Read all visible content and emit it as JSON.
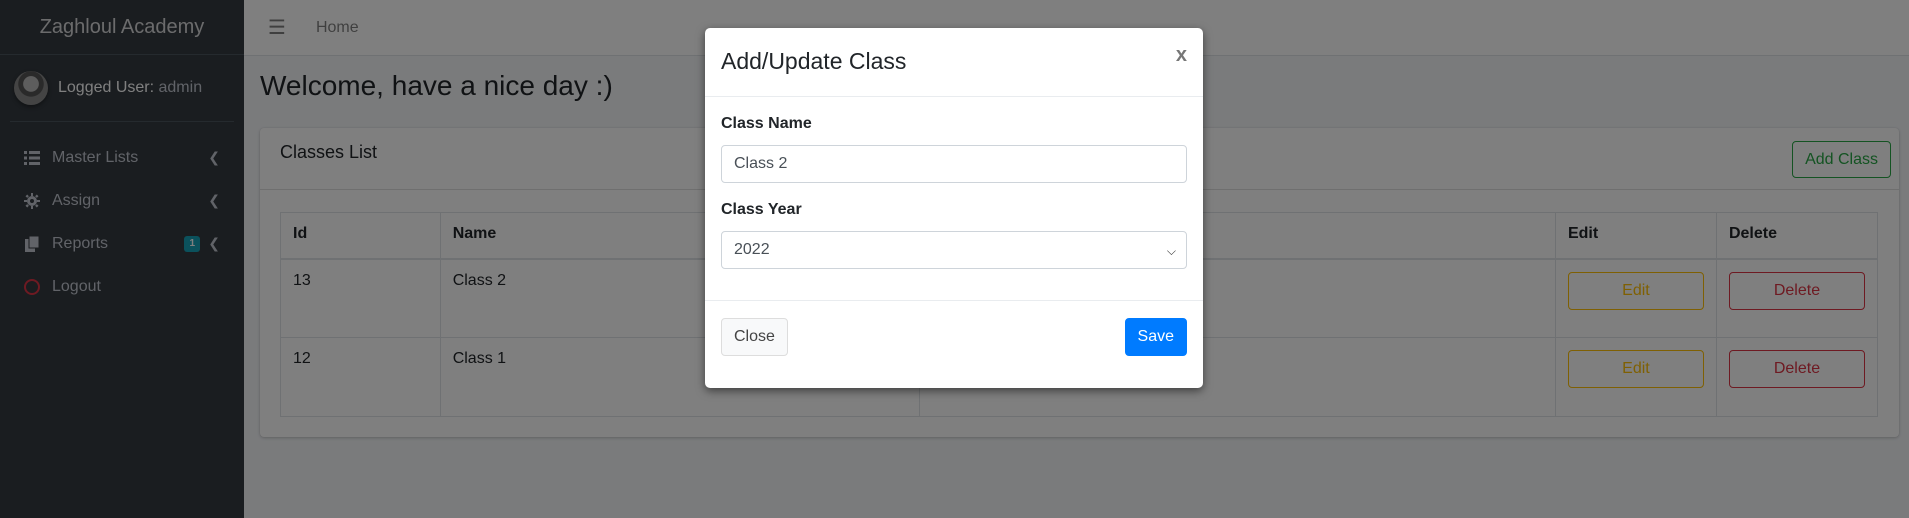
{
  "sidebar": {
    "brand": "Zaghloul Academy",
    "user_label": "Logged User:",
    "user_name": " admin",
    "items": [
      {
        "label": "Master Lists",
        "icon": "list-icon"
      },
      {
        "label": "Assign",
        "icon": "gear-icon"
      },
      {
        "label": "Reports",
        "icon": "copy-icon",
        "badge": "1"
      },
      {
        "label": "Logout",
        "icon": "circle-icon"
      }
    ]
  },
  "topbar": {
    "home_label": "Home"
  },
  "main": {
    "welcome": "Welcome, have a nice day :)",
    "card_title": "Classes List",
    "add_button": "Add Class",
    "table": {
      "headers": [
        "Id",
        "Name",
        "",
        "Edit",
        "Delete"
      ],
      "rows": [
        {
          "id": "13",
          "name": "Class 2",
          "edit": "Edit",
          "delete": "Delete"
        },
        {
          "id": "12",
          "name": "Class 1",
          "edit": "Edit",
          "delete": "Delete"
        }
      ]
    }
  },
  "modal": {
    "title": "Add/Update Class",
    "close_x": "x",
    "class_name_label": "Class Name",
    "class_name_value": "Class 2",
    "class_year_label": "Class Year",
    "class_year_value": "2022",
    "close_button": "Close",
    "save_button": "Save"
  },
  "colors": {
    "sidebar_bg": "#343a40",
    "primary": "#007bff",
    "success": "#28a745",
    "warning": "#ffc107",
    "danger": "#dc3545",
    "info": "#17a2b8"
  }
}
